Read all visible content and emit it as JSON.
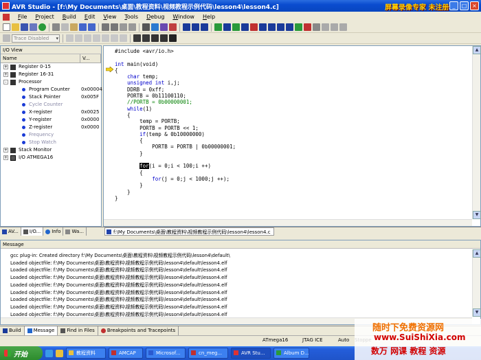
{
  "window": {
    "title": "AVR Studio - [f:\\My Documents\\桌面\\教程资料\\视频教程示例代码\\lesson4\\lesson4.c]",
    "minimize": "_",
    "maximize": "□",
    "close": "×"
  },
  "watermark_top": "屏幕录像专家  未注册",
  "menu": [
    "File",
    "Project",
    "Build",
    "Edit",
    "View",
    "Tools",
    "Debug",
    "Window",
    "Help"
  ],
  "toolbar": {
    "combo_text": "Trace Disabled"
  },
  "io_view": {
    "title": "I/O View",
    "col_name": "Name",
    "col_value": "V...",
    "rows": [
      {
        "label": "Register 0-15",
        "value": "",
        "level": 0,
        "expander": "+"
      },
      {
        "label": "Register 16-31",
        "value": "",
        "level": 0,
        "expander": "+"
      },
      {
        "label": "Processor",
        "value": "",
        "level": 0,
        "expander": "−"
      },
      {
        "label": "Program Counter",
        "value": "0x00004",
        "level": 1
      },
      {
        "label": "Stack Pointer",
        "value": "0x005F",
        "level": 1
      },
      {
        "label": "Cycle Counter",
        "value": "",
        "level": 1,
        "dim": true
      },
      {
        "label": "X-register",
        "value": "0x0025",
        "level": 1
      },
      {
        "label": "Y-register",
        "value": "0x0000",
        "level": 1
      },
      {
        "label": "Z-register",
        "value": "0x0000",
        "level": 1
      },
      {
        "label": "Frequency",
        "value": "",
        "level": 1,
        "dim": true
      },
      {
        "label": "Stop Watch",
        "value": "",
        "level": 1,
        "dim": true
      },
      {
        "label": "Stack Monitor",
        "value": "",
        "level": 0,
        "expander": "+"
      },
      {
        "label": "I/O ATMEGA16",
        "value": "",
        "level": 0,
        "expander": "+"
      }
    ]
  },
  "left_tabs": [
    "AV...",
    "I/O...",
    "Info",
    "Wa..."
  ],
  "editor": {
    "tab_label": "f:\\My Documents\\桌面\\教程资料\\视频教程示例代码\\lesson4\\lesson4.c",
    "code_lines": [
      "#include <avr/io.h>",
      "",
      "int main(void)",
      "{",
      "    char temp;",
      "    unsigned int i,j;",
      "    DDRB = 0xff;",
      "    PORTB = 0b11100110;",
      "    //PORTB = 0b00000001;",
      "    while(1)",
      "    {",
      "        temp = PORTB;",
      "        PORTB = PORTB << 1;",
      "        if(temp & 0b10000000)",
      "        {",
      "            PORTB = PORTB | 0b00000001;",
      "        }",
      "",
      "        for(i = 0;i < 100;i ++)",
      "        {",
      "            for(j = 0;j < 1000;j ++);",
      "        }",
      "    }",
      "}"
    ]
  },
  "message_panel": {
    "title": "Message",
    "lines": [
      "gcc plug-in: Created directory f:\\My Documents\\桌面\\教程资料\\视频教程示例代码\\lesson4\\default\\",
      "Loaded objectfile: f:\\My Documents\\桌面\\教程资料\\视频教程示例代码\\lesson4\\default\\lesson4.elf",
      "Loaded objectfile: f:\\My Documents\\桌面\\教程资料\\视频教程示例代码\\lesson4\\default\\lesson4.elf",
      "Loaded objectfile: f:\\My Documents\\桌面\\教程资料\\视频教程示例代码\\lesson4\\default\\lesson4.elf",
      "Loaded objectfile: f:\\My Documents\\桌面\\教程资料\\视频教程示例代码\\lesson4\\default\\lesson4.elf",
      "Loaded objectfile: f:\\My Documents\\桌面\\教程资料\\视频教程示例代码\\lesson4\\default\\lesson4.elf",
      "Loaded objectfile: f:\\My Documents\\桌面\\教程资料\\视频教程示例代码\\lesson4\\default\\lesson4.elf",
      "Loaded objectfile: f:\\My Documents\\桌面\\教程资料\\视频教程示例代码\\lesson4\\default\\lesson4.elf",
      "Loaded objectfile: f:\\My Documents\\桌面\\教程资料\\视频教程示例代码\\lesson4\\default\\lesson4.elf"
    ]
  },
  "bottom_tabs": [
    "Build",
    "Message",
    "Find in Files",
    "Breakpoints and Tracepoints"
  ],
  "status": {
    "device": "ATmega16",
    "tool": "JTAG ICE",
    "mode": "Auto",
    "state": "Stoppe"
  },
  "taskbar": {
    "start_label": "开始",
    "tasks": [
      "教程资料",
      "AMCAP",
      "Microsof...",
      "cn_meg...",
      "AVR Stu...",
      "Album D..."
    ]
  },
  "watermark_bottom": {
    "line1": "随时下免费资源网",
    "line2": "www.SuiShiXia.com",
    "line3": "数万 网课 教程 资源"
  },
  "colors": {
    "accent": "#0a4ccf",
    "keyword": "#0000cc",
    "comment": "#008000"
  }
}
